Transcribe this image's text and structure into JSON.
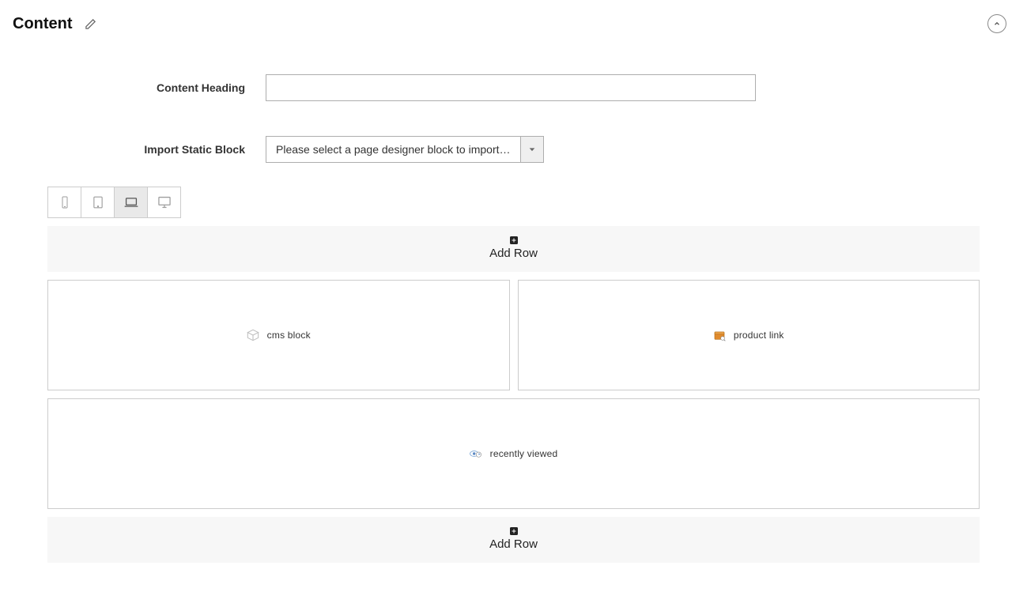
{
  "section": {
    "title": "Content"
  },
  "form": {
    "content_heading_label": "Content Heading",
    "content_heading_value": "",
    "import_block_label": "Import Static Block",
    "import_block_selected": "Please select a page designer block to import…"
  },
  "viewports": {
    "items": [
      {
        "name": "phone"
      },
      {
        "name": "tablet"
      },
      {
        "name": "laptop",
        "active": true
      },
      {
        "name": "desktop"
      }
    ]
  },
  "designer": {
    "add_row_label": "Add Row",
    "rows": [
      {
        "blocks": [
          {
            "label": "cms block",
            "icon": "cube"
          },
          {
            "label": "product link",
            "icon": "box"
          }
        ]
      },
      {
        "blocks": [
          {
            "label": "recently viewed",
            "icon": "eye"
          }
        ]
      }
    ]
  }
}
